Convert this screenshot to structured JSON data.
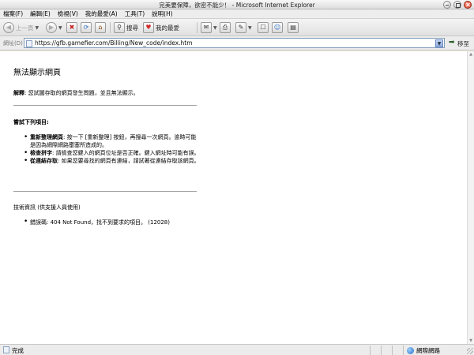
{
  "window": {
    "title": "完美要保障，欲密不能少！ - Microsoft Internet Explorer"
  },
  "menu": [
    "檔案(F)",
    "編輯(E)",
    "檢視(V)",
    "我的最愛(A)",
    "工具(T)",
    "說明(H)"
  ],
  "toolbar": {
    "back_label": "上一頁",
    "search_label": "搜尋",
    "favorites_label": "我的最愛"
  },
  "address": {
    "label": "網址(D)",
    "url": "https://gfb.gamefier.com/Billing/New_code/index.htm",
    "go_label": "移至"
  },
  "page": {
    "title": "無法顯示網頁",
    "explain_label": "解釋",
    "explain_text": ": 您試圖存取的網頁發生問題，並且無法顯示。",
    "try_heading": "嘗試下列項目:",
    "tips": [
      {
        "bold": "重新整理網頁",
        "text": ": 按一下 [重新整理] 按鈕，再搜尋一次網頁。逾時可能是因為網際網路壅塞所造成的。"
      },
      {
        "bold": "檢查拼字",
        "text": ": 請檢查您鍵入的網頁位址是否正確。鍵入網址時可能有誤。"
      },
      {
        "bold": "從連結存取",
        "text": ": 如果您要尋找的網頁有連結，請試著從連結存取該網頁。"
      }
    ],
    "tech_heading": "技術資訊 (供支援人員使用)",
    "tech_item": "錯誤碼: 404 Not Found，找不到要求的項目。 (12028)"
  },
  "status": {
    "text": "完成",
    "zone": "網際網路"
  },
  "colors": {
    "address_border": "#7f9db9",
    "go_arrow": "#2a5d2a"
  }
}
